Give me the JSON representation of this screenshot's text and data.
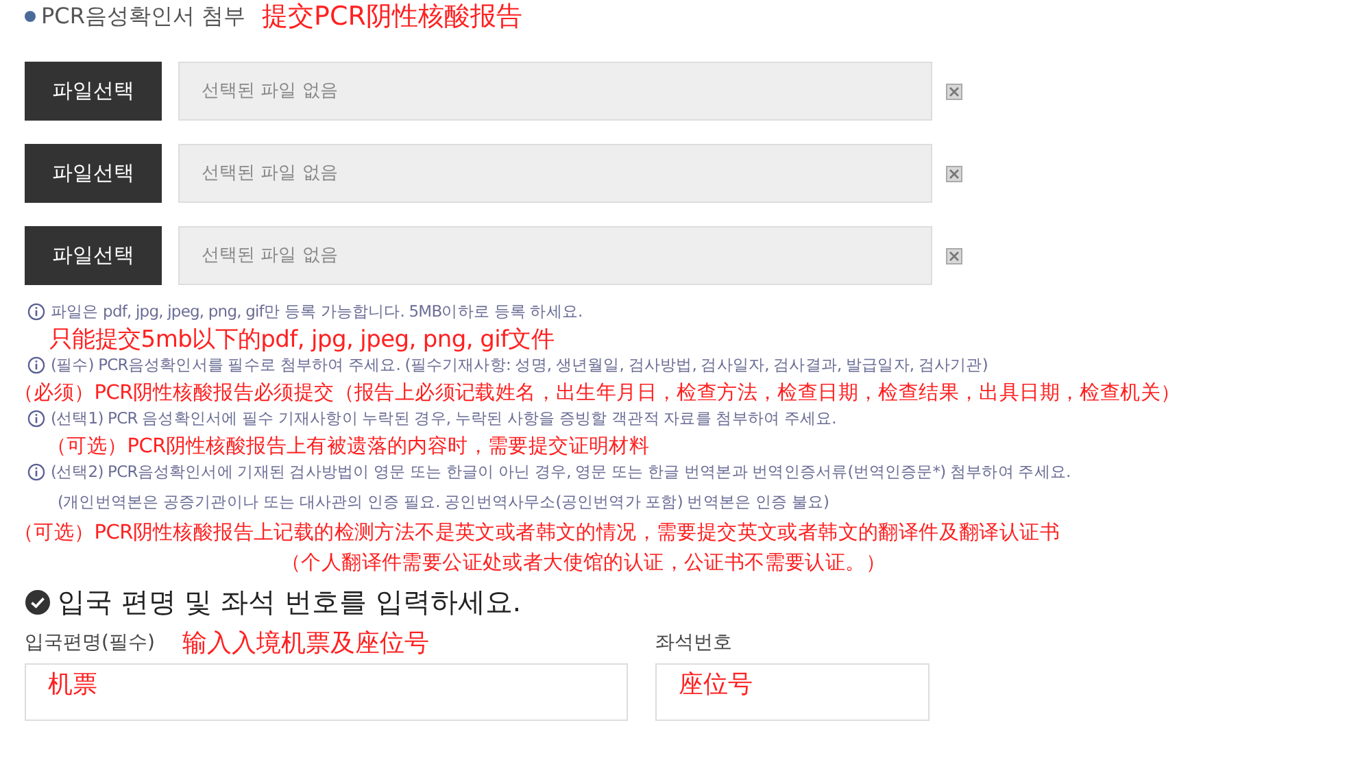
{
  "section": {
    "title": "PCR음성확인서 첨부",
    "annotation": "提交PCR阴性核酸报告"
  },
  "file_rows": [
    {
      "button": "파일선택",
      "placeholder": "선택된 파일 없음"
    },
    {
      "button": "파일선택",
      "placeholder": "선택된 파일 없음"
    },
    {
      "button": "파일선택",
      "placeholder": "선택된 파일 없음"
    }
  ],
  "notes": [
    {
      "kind": "info",
      "text": "파일은 pdf, jpg, jpeg, png, gif만 등록 가능합니다. 5MB이하로 등록 하세요."
    },
    {
      "kind": "annotation",
      "text": "只能提交5mb以下的pdf, jpg, jpeg, png, gif文件"
    },
    {
      "kind": "info",
      "text": "(필수) PCR음성확인서를 필수로 첨부하여 주세요. (필수기재사항: 성명, 생년월일, 검사방법, 검사일자, 검사결과, 발급일자, 검사기관)"
    },
    {
      "kind": "annotation",
      "text": "（必须）PCR阴性核酸报告必须提交（报告上必须记载姓名，出生年月日，检查方法，检查日期，检查结果，出具日期，检查机关）"
    },
    {
      "kind": "info",
      "text": "(선택1) PCR 음성확인서에 필수 기재사항이 누락된 경우, 누락된 사항을 증빙할 객관적 자료를 첨부하여 주세요."
    },
    {
      "kind": "annotation",
      "text": "（可选）PCR阴性核酸报告上有被遗落的内容时，需要提交证明材料"
    },
    {
      "kind": "info",
      "text": "(선택2) PCR음성확인서에 기재된 검사방법이 영문 또는 한글이 아닌 경우, 영문 또는 한글 번역본과 번역인증서류(번역인증문*) 첨부하여 주세요."
    },
    {
      "kind": "sub",
      "text": "(개인번역본은 공증기관이나 또는 대사관의 인증 필요. 공인번역사무소(공인번역가 포함) 번역본은 인증 불요)"
    },
    {
      "kind": "annotation",
      "text": "（可选）PCR阴性核酸报告上记载的检测方法不是英文或者韩文的情况，需要提交英文或者韩文的翻译件及翻译认证书"
    },
    {
      "kind": "remark",
      "text": "（个人翻译件需要公证处或者大使馆的认证，公证书不需要认证。）"
    }
  ],
  "flight": {
    "heading": "입국 편명 및 좌석 번호를 입력하세요.",
    "annotation": "输入入境机票及座位号",
    "fields": [
      {
        "label": "입국편명(필수)",
        "annotation": "机票"
      },
      {
        "label": "좌석번호",
        "annotation": "座位号"
      }
    ]
  }
}
